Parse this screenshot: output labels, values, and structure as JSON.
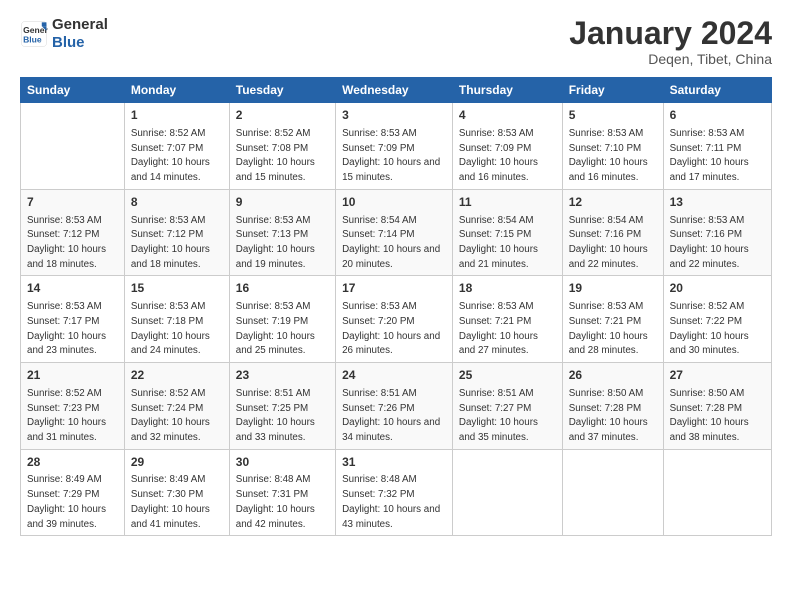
{
  "logo": {
    "line1": "General",
    "line2": "Blue"
  },
  "title": "January 2024",
  "subtitle": "Deqen, Tibet, China",
  "days": [
    "Sunday",
    "Monday",
    "Tuesday",
    "Wednesday",
    "Thursday",
    "Friday",
    "Saturday"
  ],
  "weeks": [
    [
      null,
      {
        "date": "1",
        "sunrise": "8:52 AM",
        "sunset": "7:07 PM",
        "daylight": "10 hours and 14 minutes."
      },
      {
        "date": "2",
        "sunrise": "8:52 AM",
        "sunset": "7:08 PM",
        "daylight": "10 hours and 15 minutes."
      },
      {
        "date": "3",
        "sunrise": "8:53 AM",
        "sunset": "7:09 PM",
        "daylight": "10 hours and 15 minutes."
      },
      {
        "date": "4",
        "sunrise": "8:53 AM",
        "sunset": "7:09 PM",
        "daylight": "10 hours and 16 minutes."
      },
      {
        "date": "5",
        "sunrise": "8:53 AM",
        "sunset": "7:10 PM",
        "daylight": "10 hours and 16 minutes."
      },
      {
        "date": "6",
        "sunrise": "8:53 AM",
        "sunset": "7:11 PM",
        "daylight": "10 hours and 17 minutes."
      }
    ],
    [
      {
        "date": "7",
        "sunrise": "8:53 AM",
        "sunset": "7:12 PM",
        "daylight": "10 hours and 18 minutes."
      },
      {
        "date": "8",
        "sunrise": "8:53 AM",
        "sunset": "7:12 PM",
        "daylight": "10 hours and 18 minutes."
      },
      {
        "date": "9",
        "sunrise": "8:53 AM",
        "sunset": "7:13 PM",
        "daylight": "10 hours and 19 minutes."
      },
      {
        "date": "10",
        "sunrise": "8:54 AM",
        "sunset": "7:14 PM",
        "daylight": "10 hours and 20 minutes."
      },
      {
        "date": "11",
        "sunrise": "8:54 AM",
        "sunset": "7:15 PM",
        "daylight": "10 hours and 21 minutes."
      },
      {
        "date": "12",
        "sunrise": "8:54 AM",
        "sunset": "7:16 PM",
        "daylight": "10 hours and 22 minutes."
      },
      {
        "date": "13",
        "sunrise": "8:53 AM",
        "sunset": "7:16 PM",
        "daylight": "10 hours and 22 minutes."
      }
    ],
    [
      {
        "date": "14",
        "sunrise": "8:53 AM",
        "sunset": "7:17 PM",
        "daylight": "10 hours and 23 minutes."
      },
      {
        "date": "15",
        "sunrise": "8:53 AM",
        "sunset": "7:18 PM",
        "daylight": "10 hours and 24 minutes."
      },
      {
        "date": "16",
        "sunrise": "8:53 AM",
        "sunset": "7:19 PM",
        "daylight": "10 hours and 25 minutes."
      },
      {
        "date": "17",
        "sunrise": "8:53 AM",
        "sunset": "7:20 PM",
        "daylight": "10 hours and 26 minutes."
      },
      {
        "date": "18",
        "sunrise": "8:53 AM",
        "sunset": "7:21 PM",
        "daylight": "10 hours and 27 minutes."
      },
      {
        "date": "19",
        "sunrise": "8:53 AM",
        "sunset": "7:21 PM",
        "daylight": "10 hours and 28 minutes."
      },
      {
        "date": "20",
        "sunrise": "8:52 AM",
        "sunset": "7:22 PM",
        "daylight": "10 hours and 30 minutes."
      }
    ],
    [
      {
        "date": "21",
        "sunrise": "8:52 AM",
        "sunset": "7:23 PM",
        "daylight": "10 hours and 31 minutes."
      },
      {
        "date": "22",
        "sunrise": "8:52 AM",
        "sunset": "7:24 PM",
        "daylight": "10 hours and 32 minutes."
      },
      {
        "date": "23",
        "sunrise": "8:51 AM",
        "sunset": "7:25 PM",
        "daylight": "10 hours and 33 minutes."
      },
      {
        "date": "24",
        "sunrise": "8:51 AM",
        "sunset": "7:26 PM",
        "daylight": "10 hours and 34 minutes."
      },
      {
        "date": "25",
        "sunrise": "8:51 AM",
        "sunset": "7:27 PM",
        "daylight": "10 hours and 35 minutes."
      },
      {
        "date": "26",
        "sunrise": "8:50 AM",
        "sunset": "7:28 PM",
        "daylight": "10 hours and 37 minutes."
      },
      {
        "date": "27",
        "sunrise": "8:50 AM",
        "sunset": "7:28 PM",
        "daylight": "10 hours and 38 minutes."
      }
    ],
    [
      {
        "date": "28",
        "sunrise": "8:49 AM",
        "sunset": "7:29 PM",
        "daylight": "10 hours and 39 minutes."
      },
      {
        "date": "29",
        "sunrise": "8:49 AM",
        "sunset": "7:30 PM",
        "daylight": "10 hours and 41 minutes."
      },
      {
        "date": "30",
        "sunrise": "8:48 AM",
        "sunset": "7:31 PM",
        "daylight": "10 hours and 42 minutes."
      },
      {
        "date": "31",
        "sunrise": "8:48 AM",
        "sunset": "7:32 PM",
        "daylight": "10 hours and 43 minutes."
      },
      null,
      null,
      null
    ]
  ]
}
